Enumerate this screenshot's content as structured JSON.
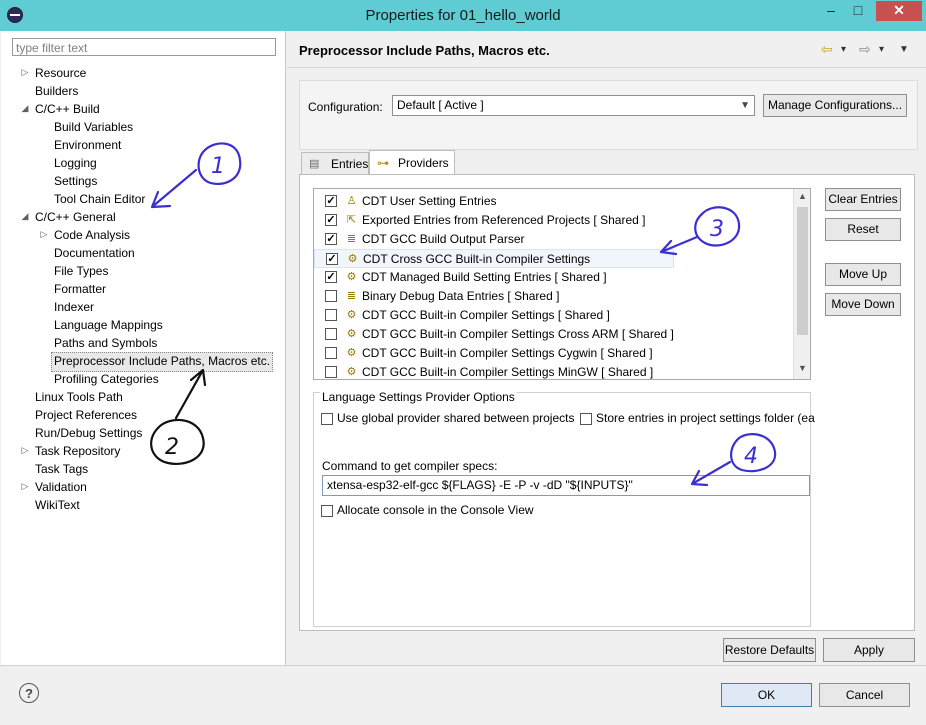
{
  "window": {
    "title": "Properties for 01_hello_world",
    "minimize_glyph": "–",
    "maximize_glyph": "□",
    "close_glyph": "✕"
  },
  "left": {
    "filter_placeholder": "type filter text",
    "tree": [
      {
        "label": "Resource",
        "twisty": "▷"
      },
      {
        "label": "Builders",
        "twisty": ""
      },
      {
        "label": "C/C++ Build",
        "twisty": "◢"
      },
      {
        "label": "Build Variables",
        "twisty": ""
      },
      {
        "label": "Environment",
        "twisty": ""
      },
      {
        "label": "Logging",
        "twisty": ""
      },
      {
        "label": "Settings",
        "twisty": ""
      },
      {
        "label": "Tool Chain Editor",
        "twisty": ""
      },
      {
        "label": "C/C++ General",
        "twisty": "◢"
      },
      {
        "label": "Code Analysis",
        "twisty": "▷"
      },
      {
        "label": "Documentation",
        "twisty": ""
      },
      {
        "label": "File Types",
        "twisty": ""
      },
      {
        "label": "Formatter",
        "twisty": ""
      },
      {
        "label": "Indexer",
        "twisty": ""
      },
      {
        "label": "Language Mappings",
        "twisty": ""
      },
      {
        "label": "Paths and Symbols",
        "twisty": ""
      },
      {
        "label": "Preprocessor Include Paths, Macros etc.",
        "twisty": ""
      },
      {
        "label": "Profiling Categories",
        "twisty": ""
      },
      {
        "label": "Linux Tools Path",
        "twisty": ""
      },
      {
        "label": "Project References",
        "twisty": ""
      },
      {
        "label": "Run/Debug Settings",
        "twisty": ""
      },
      {
        "label": "Task Repository",
        "twisty": "▷"
      },
      {
        "label": "Task Tags",
        "twisty": ""
      },
      {
        "label": "Validation",
        "twisty": "▷"
      },
      {
        "label": "WikiText",
        "twisty": ""
      }
    ]
  },
  "main": {
    "page_title": "Preprocessor Include Paths, Macros etc.",
    "nav": {
      "back": "⇦",
      "back_menu": "▾",
      "forward": "⇨",
      "forward_menu": "▾",
      "view_menu": "▼"
    },
    "configuration": {
      "label": "Configuration:",
      "value": "Default  [ Active ]",
      "manage_button": "Manage Configurations..."
    },
    "tabs": [
      {
        "label": "Entries",
        "icon": "entries-icon"
      },
      {
        "label": "Providers",
        "icon": "key-icon"
      }
    ],
    "providers": [
      {
        "label": "CDT User Setting Entries",
        "checked": true,
        "icon": "user-icon",
        "glyph": "♙"
      },
      {
        "label": "Exported Entries from Referenced Projects   [ Shared ]",
        "checked": true,
        "icon": "export-icon",
        "glyph": "⇱"
      },
      {
        "label": "CDT GCC Build Output Parser",
        "checked": true,
        "icon": "parser-icon",
        "glyph": "≣"
      },
      {
        "label": "CDT Cross GCC Built-in Compiler Settings",
        "checked": true,
        "icon": "compiler-icon",
        "glyph": "⚙"
      },
      {
        "label": "CDT Managed Build Setting Entries   [ Shared ]",
        "checked": true,
        "icon": "managed-icon",
        "glyph": "⚙"
      },
      {
        "label": "Binary Debug Data Entries   [ Shared ]",
        "checked": false,
        "icon": "binary-icon",
        "glyph": "≣"
      },
      {
        "label": "CDT GCC Built-in Compiler Settings   [ Shared ]",
        "checked": false,
        "icon": "compiler-icon",
        "glyph": "⚙"
      },
      {
        "label": "CDT GCC Built-in Compiler Settings Cross ARM   [ Shared ]",
        "checked": false,
        "icon": "compiler-icon",
        "glyph": "⚙"
      },
      {
        "label": "CDT GCC Built-in Compiler Settings Cygwin   [ Shared ]",
        "checked": false,
        "icon": "compiler-icon",
        "glyph": "⚙"
      },
      {
        "label": "CDT GCC Built-in Compiler Settings MinGW   [ Shared ]",
        "checked": false,
        "icon": "compiler-icon",
        "glyph": "⚙"
      }
    ],
    "side_buttons": {
      "clear": "Clear Entries",
      "reset": "Reset",
      "move_up": "Move Up",
      "move_down": "Move Down"
    },
    "options": {
      "title": "Language Settings Provider Options",
      "use_global": "Use global provider shared between projects",
      "store_entries": "Store entries in project settings folder (ea",
      "command_label": "Command to get compiler specs:",
      "command_value": "xtensa-esp32-elf-gcc ${FLAGS} -E -P -v -dD \"${INPUTS}\"",
      "allocate_console": "Allocate console in the Console View"
    },
    "restore_defaults": "Restore Defaults",
    "apply": "Apply"
  },
  "footer": {
    "help_glyph": "?",
    "ok": "OK",
    "cancel": "Cancel"
  },
  "annotations": {
    "a1": "1",
    "a2": "2",
    "a3": "3",
    "a4": "4"
  },
  "colors": {
    "titlebar": "#5fcbd3",
    "close_button": "#c75050",
    "annotation_ink": "#3a2fd0"
  }
}
